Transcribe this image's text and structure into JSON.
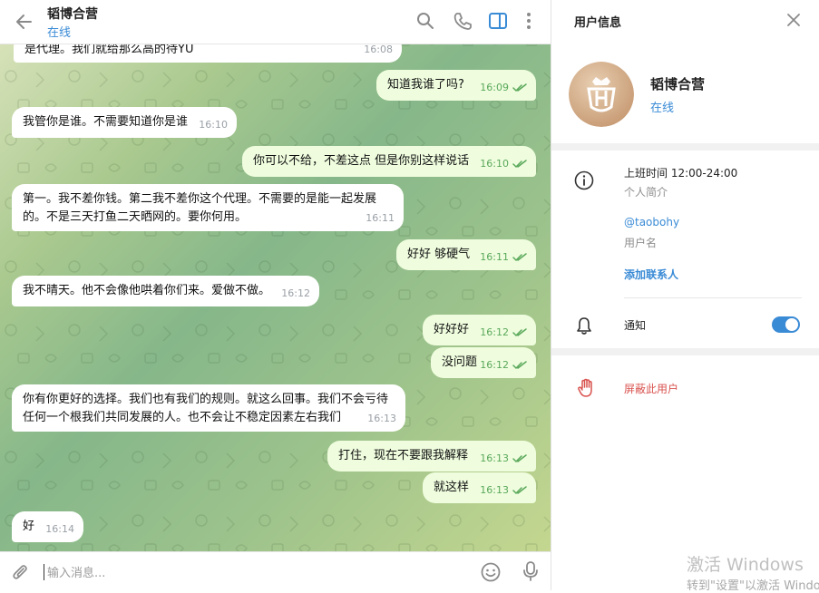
{
  "header": {
    "title": "韬博合营",
    "status": "在线",
    "icons": [
      "back-arrow-icon",
      "search-icon",
      "phone-icon",
      "sidebar-toggle-icon",
      "more-vertical-icon"
    ]
  },
  "messages": [
    {
      "side": "in",
      "text": "是代理。我们就给那么高的待YU",
      "time": "16:08"
    },
    {
      "side": "out",
      "text": "知道我谁了吗?",
      "time": "16:09"
    },
    {
      "side": "in",
      "text": "我管你是谁。不需要知道你是谁",
      "time": "16:10"
    },
    {
      "side": "out",
      "text": "你可以不给，不差这点 但是你别这样说话",
      "time": "16:10"
    },
    {
      "side": "in",
      "text": "第一。我不差你钱。第二我不差你这个代理。不需要的是能一起发展\n的。不是三天打鱼二天晒网的。要你何用。",
      "time": "16:11"
    },
    {
      "side": "out",
      "text": "好好 够硬气",
      "time": "16:11"
    },
    {
      "side": "in",
      "text": "我不晴天。他不会像他哄着你们来。爱做不做。",
      "time": "16:12"
    },
    {
      "side": "out",
      "text": "好好好",
      "time": "16:12"
    },
    {
      "side": "out",
      "text": "没问题",
      "time": "16:12"
    },
    {
      "side": "in",
      "text": "你有你更好的选择。我们也有我们的规则。就这么回事。我们不会亏待\n任何一个根我们共同发展的人。也不会让不稳定因素左右我们",
      "time": "16:13"
    },
    {
      "side": "out",
      "text": "打住，现在不要跟我解释",
      "time": "16:13"
    },
    {
      "side": "out",
      "text": "就这样",
      "time": "16:13"
    },
    {
      "side": "in",
      "text": "好",
      "time": "16:14"
    }
  ],
  "composer": {
    "placeholder": "输入消息..."
  },
  "info": {
    "title": "用户信息",
    "name": "韬博合营",
    "status": "在线",
    "bio": "上班时间 12:00-24:00",
    "bio_label": "个人简介",
    "username": "@taobohy",
    "username_label": "用户名",
    "add_contact": "添加联系人",
    "notifications_label": "通知",
    "notifications_on": true,
    "block_label": "屏蔽此用户"
  },
  "watermark": {
    "line1": "激活 Windows",
    "line2": "转到\"设置\"以激活 Windo"
  },
  "colors": {
    "accent": "#3a8bd6",
    "outgoing_bubble": "#effdde",
    "incoming_bubble": "#ffffff",
    "read_check": "#5aa85b",
    "danger": "#d9534f"
  }
}
